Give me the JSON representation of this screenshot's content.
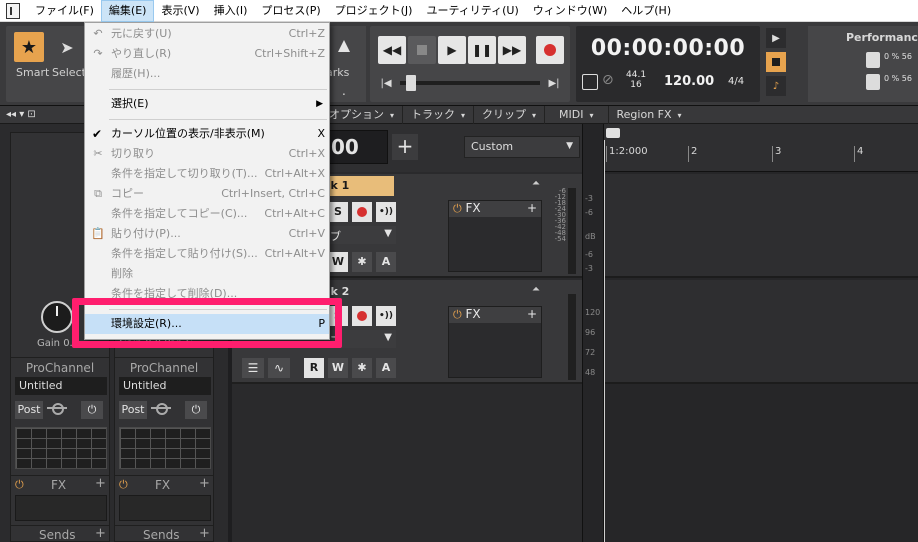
{
  "menubar": {
    "items": [
      "ファイル(F)",
      "編集(E)",
      "表示(V)",
      "挿入(I)",
      "プロセス(P)",
      "プロジェクト(J)",
      "ユーティリティ(U)",
      "ウィンドウ(W)",
      "ヘルプ(H)"
    ]
  },
  "tools": {
    "smart": "Smart",
    "select": "Select"
  },
  "markers": {
    "label": "arks",
    "dot": "."
  },
  "transport": {
    "time": "00:00:00:00",
    "rate_top": "44.1",
    "rate_bottom": "16",
    "tempo": "120.00",
    "meter": "4/4"
  },
  "performance": {
    "title": "Performance",
    "row1": "0 %  56",
    "row2": "0 %  56"
  },
  "viewbar": {
    "left": "◂◂ ▾ ⊡",
    "menus": [
      "オプション",
      "トラック",
      "クリップ",
      "MIDI",
      "Region FX"
    ]
  },
  "strips": [
    {
      "gain": "Gain",
      "gain_value": "0.0",
      "prochannel": "ProChannel",
      "preset": "Untitled",
      "post": "Post",
      "fx": "FX",
      "sends": "Sends"
    },
    {
      "gain": "Gain",
      "gain_value": "0.0  Pan  C",
      "prochannel": "ProChannel",
      "preset": "Untitled",
      "post": "Post",
      "fx": "FX",
      "sends": "Sends"
    }
  ],
  "track_header": {
    "counter": "00",
    "add": "+",
    "preset_select": "Custom"
  },
  "tracks": [
    {
      "name": "ck 1",
      "input": "ブ",
      "fx": "FX",
      "btn_s": "S",
      "btn_w": "W",
      "btn_a": "A",
      "btn_r": "R"
    },
    {
      "name": "ck 2",
      "input": "ブ",
      "fx": "FX",
      "btn_s": "S",
      "btn_w": "W",
      "btn_a": "A",
      "btn_r": "R"
    }
  ],
  "meter_scale": [
    "-6",
    "-12",
    "-18",
    "-24",
    "-30",
    "-36",
    "-42",
    "-48",
    "-54"
  ],
  "vscale_top": [
    "-3",
    "-6",
    "dB",
    "-6",
    "-3"
  ],
  "vscale_bottom": [
    "120",
    "96",
    "72",
    "48"
  ],
  "ruler": {
    "start": "1:2:000",
    "ticks": [
      "2",
      "3",
      "4"
    ]
  },
  "edit_menu": {
    "items": [
      {
        "label": "元に戻す(U)",
        "shortcut": "Ctrl+Z",
        "disabled": true
      },
      {
        "label": "やり直し(R)",
        "shortcut": "Ctrl+Shift+Z",
        "disabled": true
      },
      {
        "label": "履歴(H)...",
        "shortcut": "",
        "disabled": true
      },
      {
        "label": "選択(E)",
        "shortcut": "",
        "disabled": false
      },
      {
        "label": "カーソル位置の表示/非表示(M)",
        "shortcut": "X",
        "disabled": false
      },
      {
        "label": "切り取り",
        "shortcut": "Ctrl+X",
        "disabled": true
      },
      {
        "label": "条件を指定して切り取り(T)...",
        "shortcut": "Ctrl+Alt+X",
        "disabled": true
      },
      {
        "label": "コピー",
        "shortcut": "Ctrl+Insert, Ctrl+C",
        "disabled": true
      },
      {
        "label": "条件を指定してコピー(C)...",
        "shortcut": "Ctrl+Alt+C",
        "disabled": true
      },
      {
        "label": "貼り付け(P)...",
        "shortcut": "Ctrl+V",
        "disabled": true
      },
      {
        "label": "条件を指定して貼り付け(S)...",
        "shortcut": "Ctrl+Alt+V",
        "disabled": true
      },
      {
        "label": "削除",
        "shortcut": "",
        "disabled": true
      },
      {
        "label": "条件を指定して削除(D)...",
        "shortcut": "",
        "disabled": true
      },
      {
        "label": "環境設定(R)...",
        "shortcut": "P",
        "disabled": false
      }
    ]
  },
  "colors": {
    "accent": "#e7a34e",
    "highlight_box": "#ff1e6e",
    "menu_hover": "#c6e0f7"
  }
}
